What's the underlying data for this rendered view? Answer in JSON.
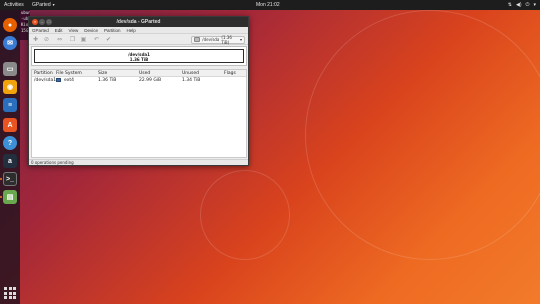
{
  "topbar": {
    "activities": "Activities",
    "app_menu": "GParted",
    "clock": "Mon 21:02",
    "tray_icons": [
      "network-icon",
      "volume-icon",
      "power-icon",
      "chevron-down-icon"
    ]
  },
  "dock": {
    "items": [
      {
        "name": "firefox",
        "color": "#e66000"
      },
      {
        "name": "thunderbird",
        "color": "#3a7bd5"
      },
      {
        "name": "files",
        "color": "#8a8a8a"
      },
      {
        "name": "rhythmbox",
        "color": "#f0a30a"
      },
      {
        "name": "libreoffice-writer",
        "color": "#2a6fbd"
      },
      {
        "name": "ubuntu-software",
        "color": "#e95420"
      },
      {
        "name": "help",
        "color": "#3d8fd6"
      },
      {
        "name": "amazon",
        "color": "#232f3e"
      },
      {
        "name": "terminal",
        "color": "#2d2d2d"
      },
      {
        "name": "gparted",
        "color": "#6aa84f"
      }
    ]
  },
  "background_terminal": {
    "lines": [
      "ubun",
      "-ub",
      "Kio",
      "15G"
    ]
  },
  "window": {
    "title": "/dev/sda - GParted",
    "menu": [
      "GParted",
      "Edit",
      "View",
      "Device",
      "Partition",
      "Help"
    ],
    "device_selector": {
      "device": "/dev/sda",
      "size": "(1.36 TiB)"
    },
    "disk_map": {
      "partition": "/dev/sda1",
      "size": "1.36 TiB"
    },
    "columns": [
      "Partition",
      "File System",
      "Size",
      "Used",
      "Unused",
      "Flags"
    ],
    "rows": [
      {
        "partition": "/dev/sda1",
        "filesystem": "ext4",
        "size": "1.36 TiB",
        "used": "22.99 GiB",
        "unused": "1.34 TiB",
        "flags": "",
        "fs_color": "#3b6aa0"
      }
    ],
    "status": "0 operations pending"
  }
}
